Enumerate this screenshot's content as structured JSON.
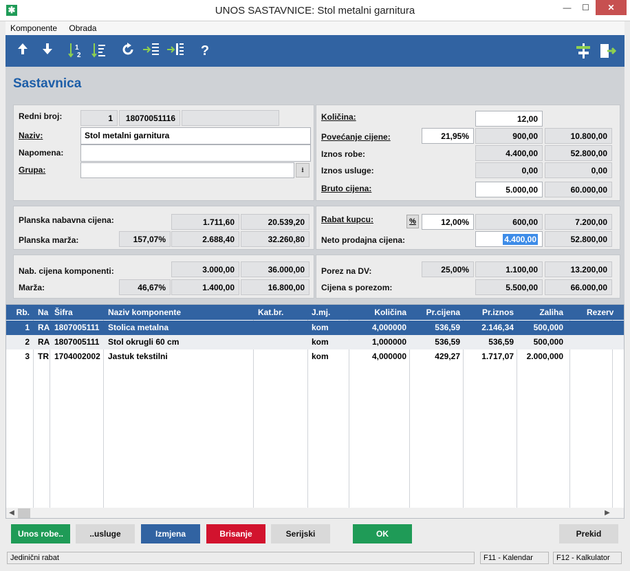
{
  "window": {
    "title": "UNOS SASTAVNICE: Stol metalni garnitura",
    "icon": "app-icon"
  },
  "menu": [
    "Komponente",
    "Obrada"
  ],
  "toolbar": {
    "icons": [
      "arrow-up-icon",
      "arrow-down-icon",
      "sort-12-icon",
      "sort-list-icon",
      "refresh-icon",
      "move-in-icon",
      "move-in-all-icon",
      "help-icon",
      "settings-icon",
      "exit-icon"
    ],
    "help": "?"
  },
  "page": {
    "title": "Sastavnica"
  },
  "form": {
    "redni_broj_label": "Redni broj:",
    "redni_broj": "1",
    "sifra": "18070051116",
    "extra": "",
    "naziv_label": "Naziv:",
    "naziv": "Stol metalni garnitura",
    "napomena_label": "Napomena:",
    "napomena": "",
    "grupa_label": "Grupa:",
    "grupa": ""
  },
  "right_top": {
    "kolicina_label": "Količina:",
    "kolicina": "12,00",
    "povecanje_label": "Povećanje cijene:",
    "povecanje_pct": "21,95%",
    "povecanje_val": "900,00",
    "povecanje_total": "10.800,00",
    "iznos_robe_label": "Iznos robe:",
    "iznos_robe": "4.400,00",
    "iznos_robe_total": "52.800,00",
    "iznos_usluge_label": "Iznos usluge:",
    "iznos_usluge": "0,00",
    "iznos_usluge_total": "0,00",
    "bruto_label": "Bruto cijena:",
    "bruto": "5.000,00",
    "bruto_total": "60.000,00"
  },
  "planska": {
    "nabavna_label": "Planska nabavna cijena:",
    "nabavna": "1.711,60",
    "nabavna_total": "20.539,20",
    "marza_label": "Planska marža:",
    "marza_pct": "157,07%",
    "marza": "2.688,40",
    "marza_total": "32.260,80"
  },
  "rabat": {
    "rabat_label": "Rabat kupcu:",
    "pct_btn": "%",
    "rabat_pct": "12,00%",
    "rabat_val": "600,00",
    "rabat_total": "7.200,00",
    "neto_label": "Neto prodajna cijena:",
    "neto": "4.400,00",
    "neto_total": "52.800,00"
  },
  "komponente": {
    "nab_label": "Nab. cijena komponenti:",
    "nab": "3.000,00",
    "nab_total": "36.000,00",
    "marza_label": "Marža:",
    "marza_pct": "46,67%",
    "marza": "1.400,00",
    "marza_total": "16.800,00"
  },
  "porez": {
    "porez_label": "Porez na DV:",
    "porez_pct": "25,00%",
    "porez": "1.100,00",
    "porez_total": "13.200,00",
    "s_porezom_label": "Cijena s porezom:",
    "s_porezom": "5.500,00",
    "s_porezom_total": "66.000,00"
  },
  "table": {
    "headers": [
      "Rb.",
      "Na",
      "Šifra",
      "Naziv komponente",
      "Kat.br.",
      "J.mj.",
      "Količina",
      "Pr.cijena",
      "Pr.iznos",
      "Zaliha",
      "Rezerv"
    ],
    "rows": [
      [
        "1",
        "RA",
        "1807005111",
        "Stolica metalna",
        "",
        "kom",
        "4,000000",
        "536,59",
        "2.146,34",
        "500,000",
        ""
      ],
      [
        "2",
        "RA",
        "1807005111",
        "Stol okrugli 60 cm",
        "",
        "kom",
        "1,000000",
        "536,59",
        "536,59",
        "500,000",
        ""
      ],
      [
        "3",
        "TR",
        "1704002002",
        "Jastuk tekstilni",
        "",
        "kom",
        "4,000000",
        "429,27",
        "1.717,07",
        "2.000,000",
        ""
      ]
    ]
  },
  "buttons": {
    "unos_robe": "Unos robe..",
    "usluge": "..usluge",
    "izmjena": "Izmjena",
    "brisanje": "Brisanje",
    "serijski": "Serijski",
    "ok": "OK",
    "prekid": "Prekid"
  },
  "status": {
    "msg": "Jedinični rabat",
    "f11": "F11 - Kalendar",
    "f12": "F12 - Kalkulator"
  },
  "colors": {
    "accent": "#3163a2",
    "green": "#1f9b57",
    "red": "#d2132e",
    "title": "#1d5ea8"
  }
}
